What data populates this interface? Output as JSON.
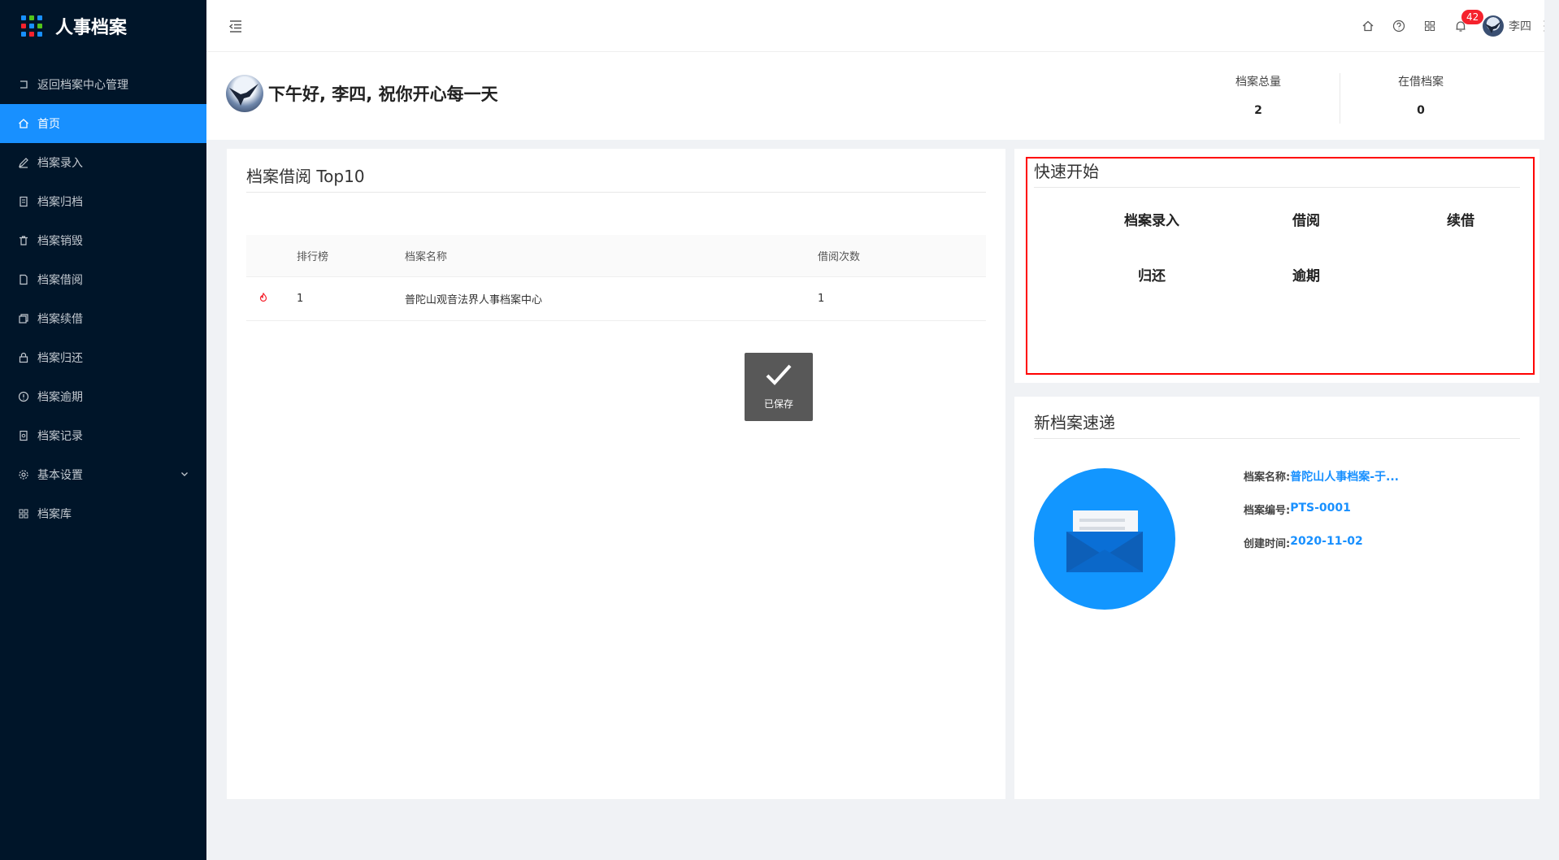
{
  "app": {
    "title": "人事档案"
  },
  "sidebar": {
    "items": [
      {
        "label": "返回档案中心管理",
        "icon": "return-icon"
      },
      {
        "label": "首页",
        "icon": "home-icon",
        "active": true
      },
      {
        "label": "档案录入",
        "icon": "edit-icon"
      },
      {
        "label": "档案归档",
        "icon": "archive-icon"
      },
      {
        "label": "档案销毁",
        "icon": "trash-icon"
      },
      {
        "label": "档案借阅",
        "icon": "file-icon"
      },
      {
        "label": "档案续借",
        "icon": "copy-icon"
      },
      {
        "label": "档案归还",
        "icon": "lock-icon"
      },
      {
        "label": "档案逾期",
        "icon": "alert-icon"
      },
      {
        "label": "档案记录",
        "icon": "record-icon"
      },
      {
        "label": "基本设置",
        "icon": "gear-icon",
        "has_submenu": true
      },
      {
        "label": "档案库",
        "icon": "grid-icon"
      }
    ]
  },
  "header": {
    "notification_count": "42",
    "user_name": "李四"
  },
  "welcome": {
    "greeting": "下午好, 李四, 祝你开心每一天",
    "stats": [
      {
        "label": "档案总量",
        "value": "2"
      },
      {
        "label": "在借档案",
        "value": "0"
      }
    ]
  },
  "top10": {
    "title": "档案借阅 Top10",
    "columns": [
      "",
      "排行榜",
      "档案名称",
      "借阅次数"
    ],
    "rows": [
      {
        "rank": "1",
        "name": "普陀山观音法界人事档案中心",
        "count": "1"
      }
    ]
  },
  "toast": {
    "text": "已保存"
  },
  "quick_start": {
    "title": "快速开始",
    "items": [
      "档案录入",
      "借阅",
      "续借",
      "归还",
      "逾期"
    ]
  },
  "new_file": {
    "title": "新档案速递",
    "fields": [
      {
        "label": "档案名称:",
        "value": "普陀山人事档案-于..."
      },
      {
        "label": "档案编号:",
        "value": "PTS-0001"
      },
      {
        "label": "创建时间:",
        "value": "2020-11-02"
      }
    ]
  },
  "colors": {
    "sidebar_bg": "#001529",
    "primary": "#1890ff",
    "highlight": "#ff0000"
  }
}
